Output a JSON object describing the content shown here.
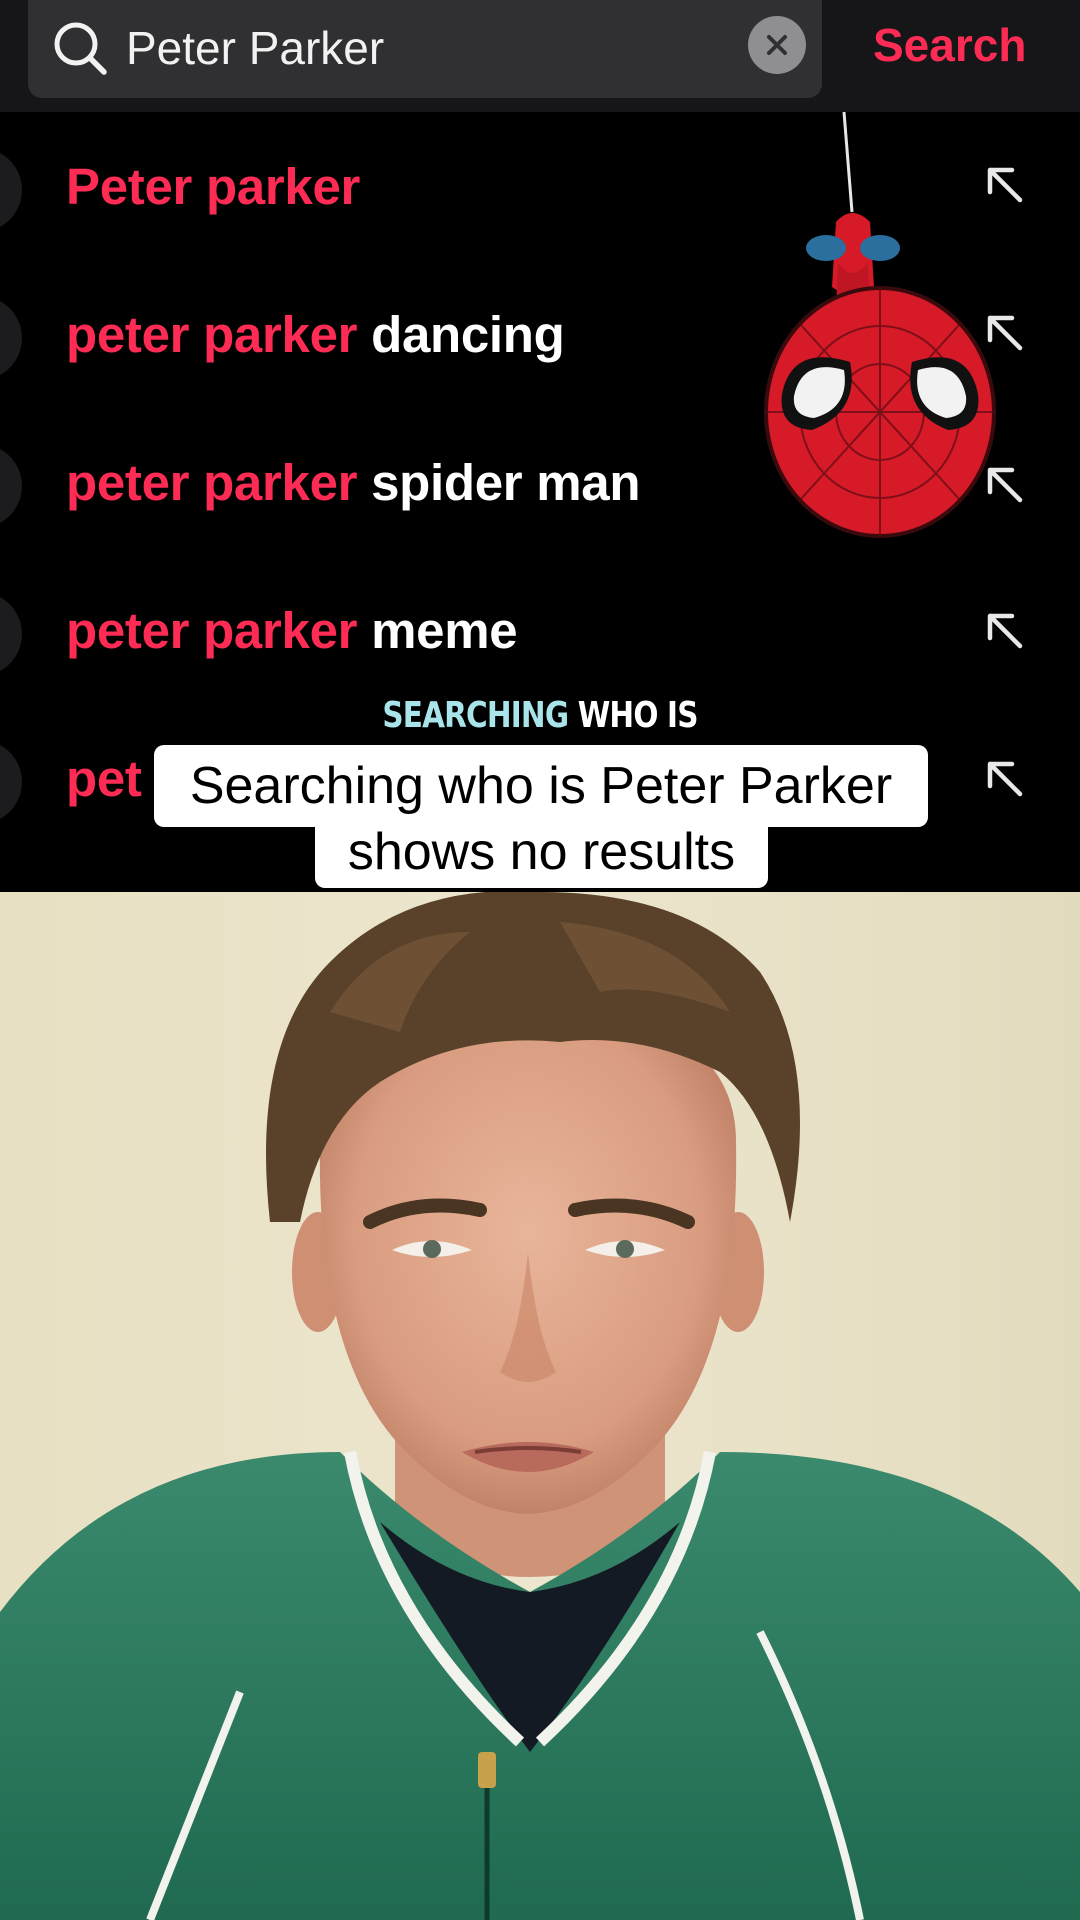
{
  "search": {
    "query": "Peter Parker",
    "submit_label": "Search"
  },
  "suggestions": [
    {
      "query_part": "Peter parker",
      "suffix": ""
    },
    {
      "query_part": "peter parker",
      "suffix": " dancing"
    },
    {
      "query_part": "peter parker",
      "suffix": " spider man"
    },
    {
      "query_part": "peter parker",
      "suffix": " meme"
    },
    {
      "query_part": "pet",
      "suffix": ""
    }
  ],
  "caption": {
    "kicker_highlight": "SEARCHING",
    "kicker_rest": " WHO IS",
    "line1": "Searching who is Peter Parker",
    "line2": "shows no results"
  },
  "icons": {
    "search": "search-icon",
    "clear": "clear-x-icon",
    "suggestion_arrow": "arrow-up-left-icon",
    "sticker": "spiderman-sticker"
  },
  "colors": {
    "accent": "#fe2c55",
    "caption_highlight": "#a9e4ea",
    "search_field": "#303033"
  }
}
